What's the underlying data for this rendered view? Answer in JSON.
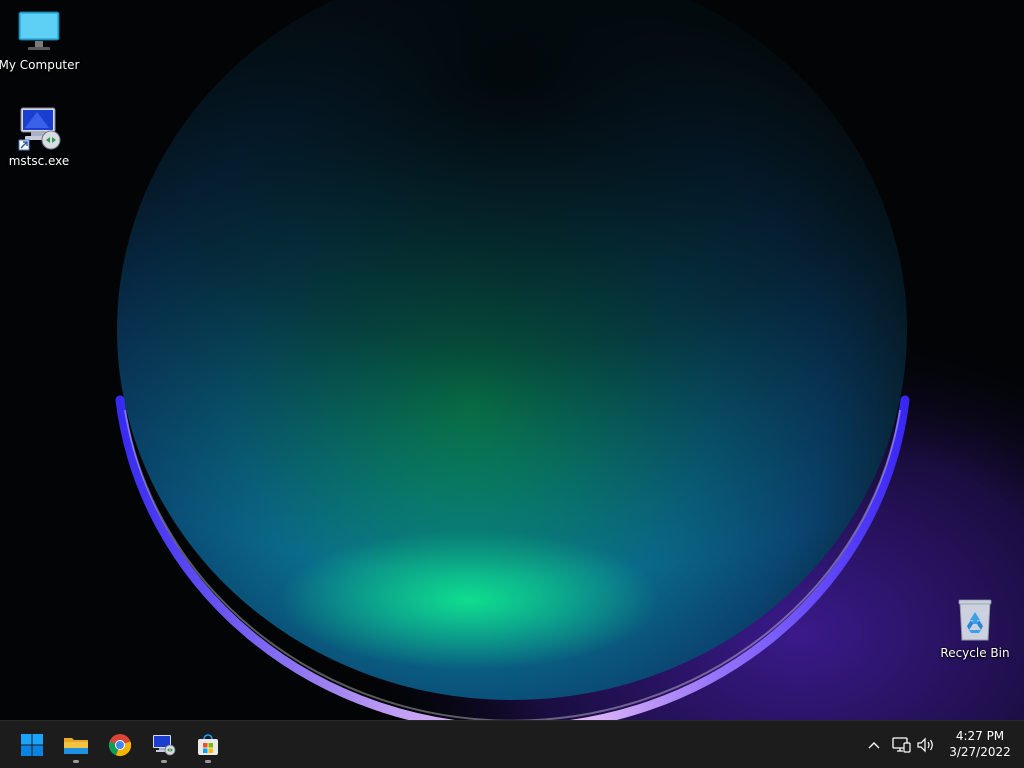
{
  "desktop": {
    "icons": [
      {
        "label": "My Computer",
        "icon": "monitor-icon"
      },
      {
        "label": "mstsc.exe",
        "icon": "remote-desktop-icon"
      },
      {
        "label": "Recycle Bin",
        "icon": "recycle-bin-icon"
      }
    ]
  },
  "taskbar": {
    "apps": [
      {
        "name": "Start",
        "icon": "windows-start-icon",
        "running": false
      },
      {
        "name": "File Explorer",
        "icon": "folder-icon",
        "running": true
      },
      {
        "name": "Google Chrome",
        "icon": "chrome-icon",
        "running": false
      },
      {
        "name": "Remote Desktop Connection",
        "icon": "remote-desktop-icon",
        "running": true
      },
      {
        "name": "Microsoft Store",
        "icon": "store-icon",
        "running": true
      }
    ],
    "tray": {
      "overflow_icon": "chevron-up-icon",
      "network_icon": "network-icon",
      "volume_icon": "volume-icon"
    },
    "clock": {
      "time": "4:27 PM",
      "date": "3/27/2022"
    }
  },
  "colors": {
    "taskbar_bg": "#1c1c1c",
    "windows_blue": "#0a84e0",
    "folder_yellow": "#f4c242"
  }
}
